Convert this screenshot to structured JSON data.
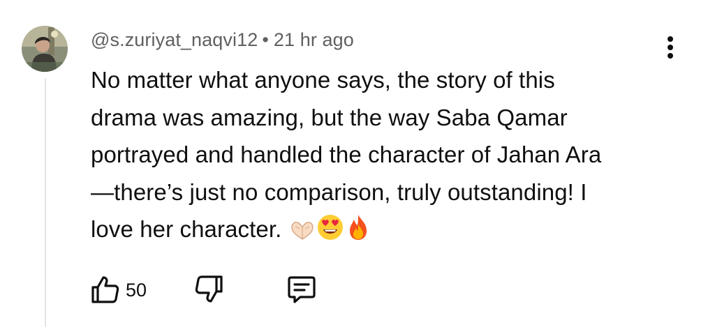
{
  "comment": {
    "author": "@s.zuriyat_naqvi12",
    "separator": "•",
    "timestamp": "21 hr ago",
    "lines": [
      "No matter what anyone says, the story of this",
      "drama was amazing, but the way Saba Qamar",
      "portrayed and handled the character of Jahan Ara",
      "—there’s just no comparison, truly outstanding! I",
      "love her character."
    ],
    "emojis": [
      "heart-hands-emoji",
      "heart-eyes-emoji",
      "fire-emoji"
    ]
  },
  "actions": {
    "like_count": "50",
    "icons": [
      "thumbs-up-icon",
      "thumbs-down-icon",
      "reply-icon",
      "more-vert-icon"
    ]
  },
  "colors": {
    "text": "#0f0f0f",
    "meta": "#606060",
    "thread_line": "#e5e5e5"
  }
}
